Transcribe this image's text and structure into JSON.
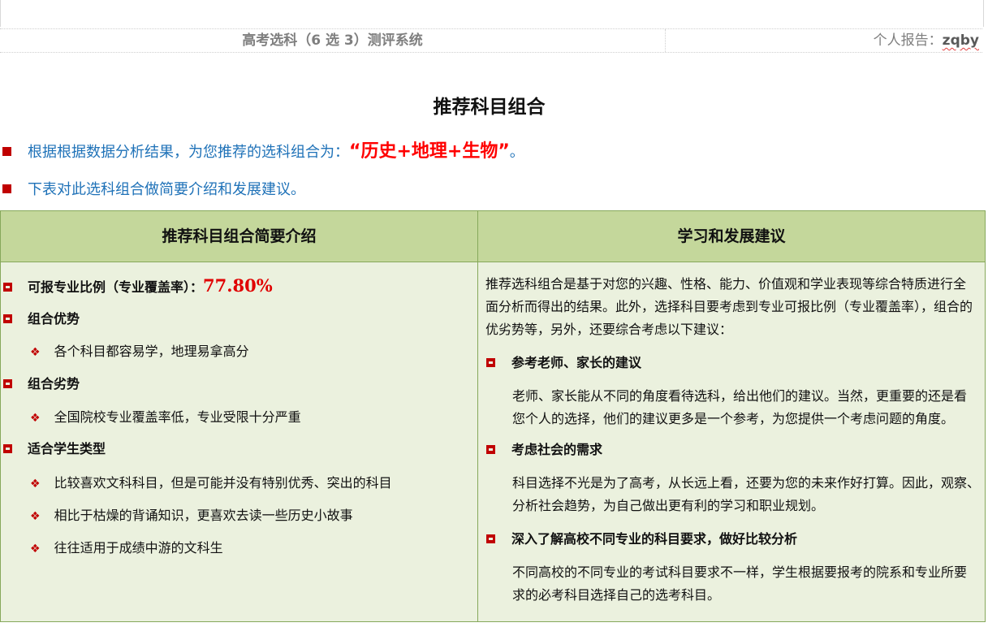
{
  "header": {
    "system_title": "高考选科（6 选 3）测评系统",
    "report_label": "个人报告：",
    "user_name": "zqby"
  },
  "heading": "推荐科目组合",
  "intro": {
    "line1_prefix": "根据根据数据分析结果，为您推荐的选科组合为：",
    "combo": "“历史+地理+生物”",
    "line1_suffix": "。",
    "line2": "下表对此选科组合做简要介绍和发展建议。"
  },
  "table": {
    "left_header": "推荐科目组合简要介绍",
    "right_header": "学习和发展建议",
    "left": {
      "coverage_label": "可报专业比例（专业覆盖率）：",
      "coverage_value": "77.80%",
      "advantages_title": "组合优势",
      "advantages": [
        "各个科目都容易学，地理易拿高分"
      ],
      "disadvantages_title": "组合劣势",
      "disadvantages": [
        "全国院校专业覆盖率低，专业受限十分严重"
      ],
      "student_type_title": "适合学生类型",
      "student_types": [
        "比较喜欢文科科目，但是可能并没有特别优秀、突出的科目",
        "相比于枯燥的背诵知识，更喜欢去读一些历史小故事",
        "往往适用于成绩中游的文科生"
      ]
    },
    "right": {
      "intro_line1": "推荐选科组合是基于对您的兴趣、性格、能力、价值观和学业表现等综合特质进行全",
      "intro_line2": "面分析而得出的结果。此外，选择科目要考虑到专业可报比例（专业覆盖率），组合的",
      "intro_line3": "优劣势等，另外，还要综合考虑以下建议：",
      "items": [
        {
          "title": "参考老师、家长的建议",
          "line1": "老师、家长能从不同的角度看待选科，给出他们的建议。当然，更重要的还是看",
          "line2": "您个人的选择，他们的建议更多是一个参考，为您提供一个考虑问题的角度。"
        },
        {
          "title": "考虑社会的需求",
          "line1": "科目选择不光是为了高考，从长远上看，还要为您的未来作好打算。因此，观察、",
          "line2": "分析社会趋势，为自己做出更有利的学习和职业规划。"
        },
        {
          "title": "深入了解高校不同专业的科目要求，做好比较分析",
          "line1": "不同高校的不同专业的考试科目要求不一样，学生根据要报考的院系和专业所要",
          "line2": "求的必考科目选择自己的选考科目。"
        }
      ]
    }
  },
  "colors": {
    "accent_red": "#c00000",
    "intro_blue": "#1f72b8",
    "header_green": "#c4d79b",
    "body_green": "#ebf1de",
    "border_green": "#86a85b"
  }
}
